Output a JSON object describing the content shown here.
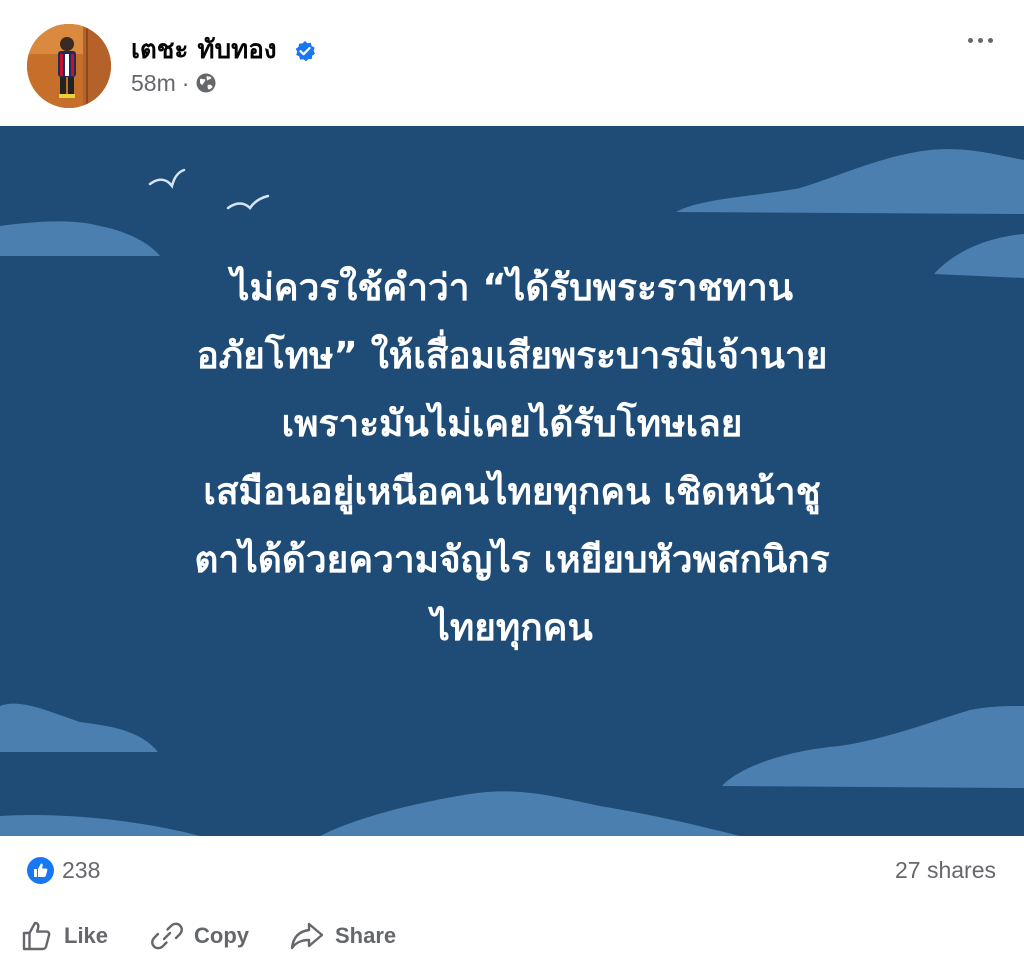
{
  "post": {
    "author": {
      "name": "เตชะ ทับทอง",
      "verified": true
    },
    "timestamp": "58m",
    "separator": "·",
    "audience_icon": "globe-icon",
    "more_icon": "more-options-icon",
    "background": {
      "color": "#1f4c77",
      "cloud_color": "#4b7fb0",
      "bird_color": "#d7e4f2"
    },
    "text_lines": [
      "ไม่ควรใช้คำว่า “ได้รับพระราชทาน",
      "อภัยโทษ” ให้เสื่อมเสียพระบารมีเจ้านาย",
      "เพราะมันไม่เคยได้รับโทษเลย",
      "เสมือนอยู่เหนือคนไทยทุกคน  เชิดหน้าชู",
      "ตาได้ด้วยความจัญไร เหยียบหัวพสกนิกร",
      "ไทยทุกคน"
    ]
  },
  "reactions": {
    "icon": "like-reaction-icon",
    "color": "#1877f2",
    "count": "238",
    "shares": "27 shares"
  },
  "actions": {
    "like": {
      "label": "Like",
      "icon": "thumbs-up-icon"
    },
    "copy": {
      "label": "Copy",
      "icon": "link-icon"
    },
    "share": {
      "label": "Share",
      "icon": "share-arrow-icon"
    }
  }
}
